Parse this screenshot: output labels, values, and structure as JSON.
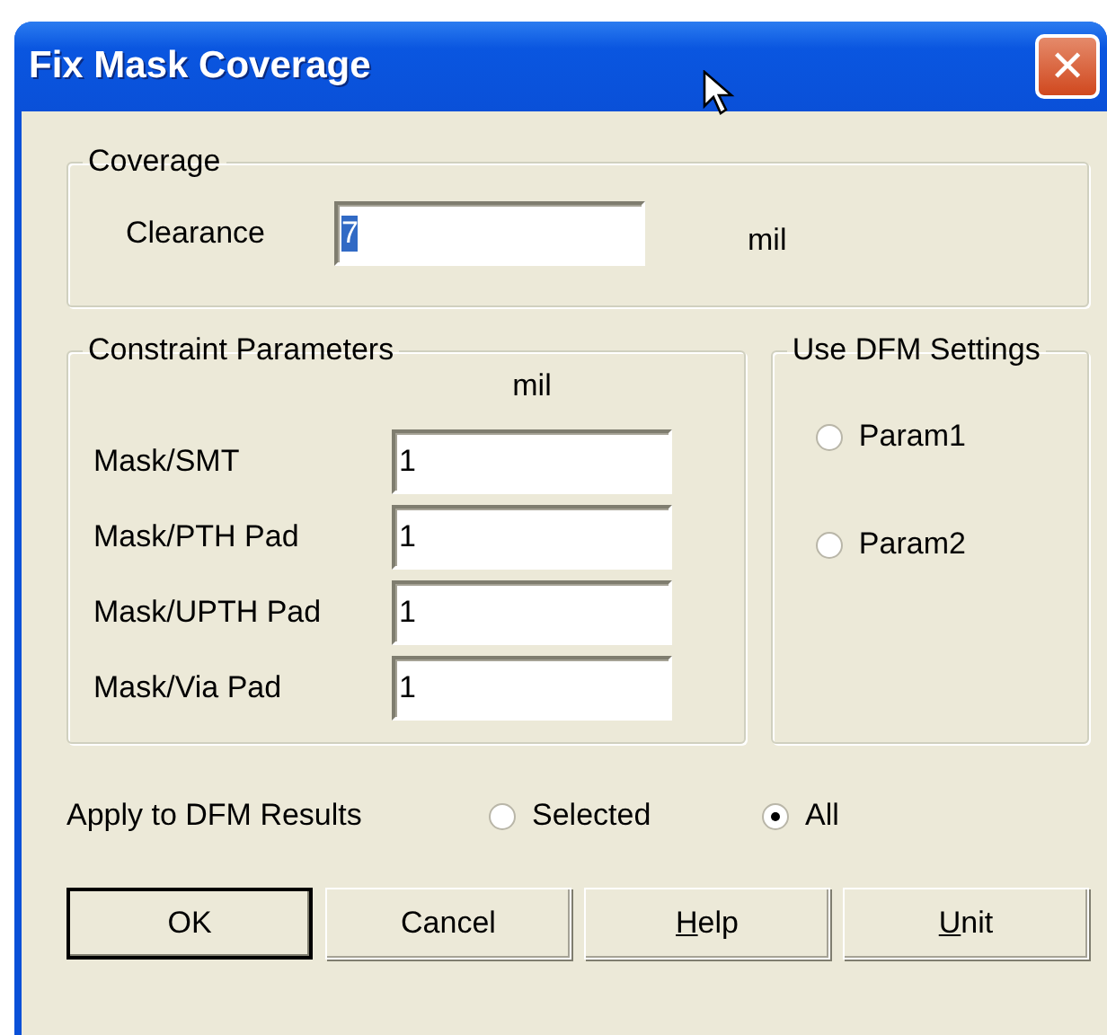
{
  "window": {
    "title": "Fix Mask Coverage",
    "close": "✕"
  },
  "coverage": {
    "title": "Coverage",
    "label": "Clearance",
    "value": "7",
    "value_selected": true,
    "unit": "mil"
  },
  "constraints": {
    "title": "Constraint Parameters",
    "unit": "mil",
    "rows": [
      {
        "label": "Mask/SMT",
        "value": "1"
      },
      {
        "label": "Mask/PTH Pad",
        "value": "1"
      },
      {
        "label": "Mask/UPTH Pad",
        "value": "1"
      },
      {
        "label": "Mask/Via Pad",
        "value": "1"
      }
    ]
  },
  "dfm_settings": {
    "title": "Use DFM Settings",
    "options": [
      {
        "label": "Param1",
        "selected": false
      },
      {
        "label": "Param2",
        "selected": false
      }
    ]
  },
  "apply": {
    "label": "Apply to DFM Results",
    "options": [
      {
        "label": "Selected",
        "selected": false
      },
      {
        "label": "All",
        "selected": true
      }
    ]
  },
  "buttons": [
    {
      "label": "OK",
      "default": true,
      "underline_first": false
    },
    {
      "label": "Cancel",
      "default": false,
      "underline_first": false
    },
    {
      "label": "Help",
      "default": false,
      "underline_first": true
    },
    {
      "label": "Unit",
      "default": false,
      "underline_first": true
    }
  ]
}
